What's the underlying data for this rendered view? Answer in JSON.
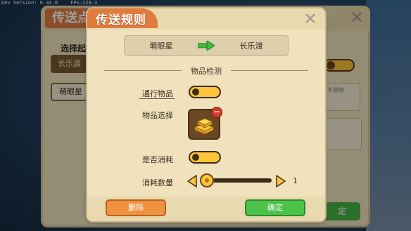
{
  "status_bar": {
    "dev_version": "Dev Version: 0.34.0",
    "fps": "FPS:228.3"
  },
  "background_panel": {
    "title": "传送点",
    "select_label": "选择起",
    "button_1": "长乐渡",
    "button_2": "萌眼星",
    "side_note": "不限制",
    "bottom_button": "定"
  },
  "dialog": {
    "title": "传送规则",
    "route": {
      "from": "萌眼星",
      "to": "长乐渡"
    },
    "section_title": "物品检测",
    "pass_item_label": "通行物品",
    "pass_item_enabled": true,
    "item_select_label": "物品选择",
    "selected_item_icon": "gold-bars-icon",
    "consume_label": "是否消耗",
    "consume_enabled": true,
    "consume_count_label": "消耗数量",
    "consume_count": "1",
    "delete_button": "删除",
    "confirm_button": "确定"
  },
  "colors": {
    "title_orange": "#e07b3e",
    "toggle_on": "#ffc43a",
    "confirm_green": "#4cc24a",
    "delete_orange": "#ef9240",
    "panel_bg": "#efe2bd"
  }
}
